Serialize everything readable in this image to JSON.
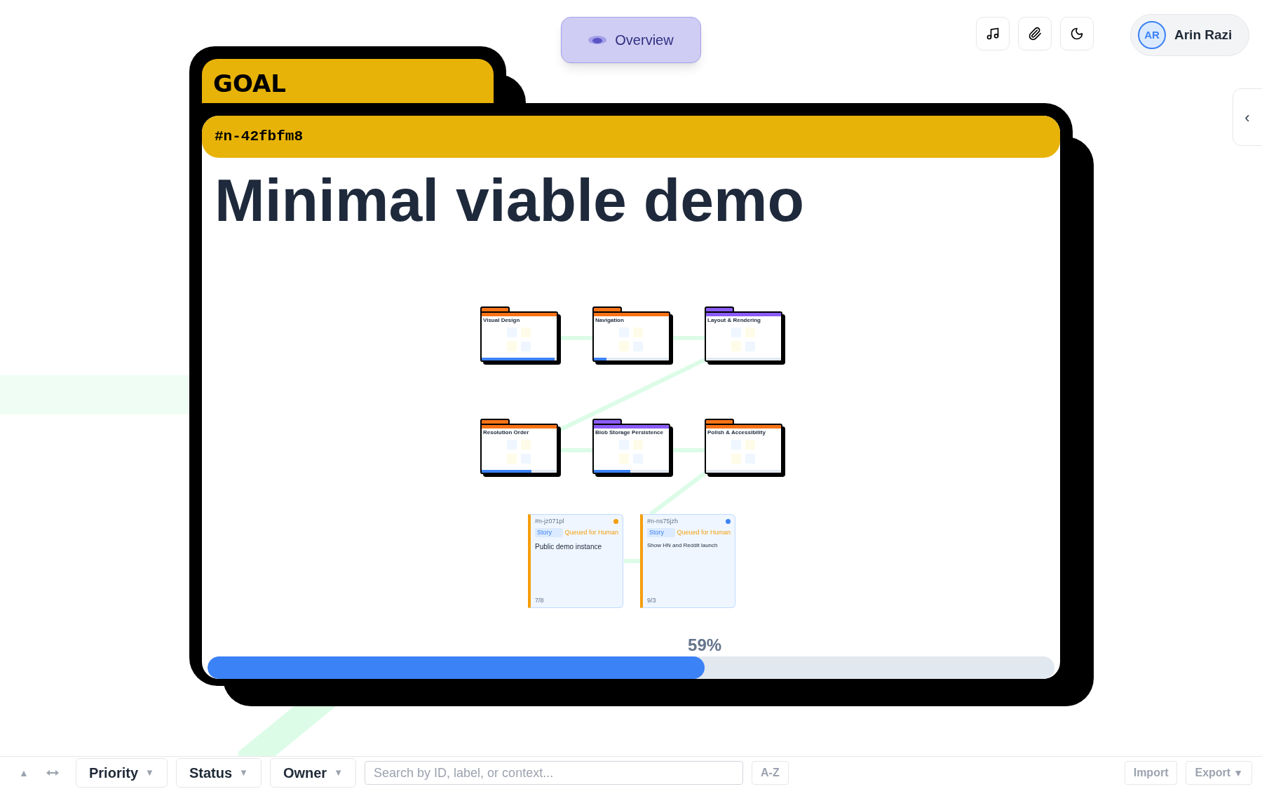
{
  "top_bar": {
    "overview_button": "Overview",
    "user": {
      "initials": "AR",
      "name": "Arin Razi"
    }
  },
  "side_toggle": "‹",
  "goal": {
    "tab": "GOAL",
    "id": "#n-42fbfm8",
    "title": "Minimal viable demo",
    "epics": [
      {
        "title": "Visual Design",
        "color": "#f97316",
        "level": 0.97
      },
      {
        "title": "Navigation",
        "color": "#f97316",
        "level": 0.17
      },
      {
        "title": "Layout & Rendering",
        "color": "#8b5cf6",
        "level": 0
      },
      {
        "title": "Resolution Order",
        "color": "#f97316",
        "level": 0.66
      },
      {
        "title": "Blob Storage Persistence",
        "color": "#8b5cf6",
        "level": 0.49
      },
      {
        "title": "Polish & Accessibility",
        "color": "#f97316",
        "level": 0
      }
    ],
    "stories": [
      {
        "id": "#n-jz071pl",
        "type": "Story",
        "status": "Queued for Human",
        "title": "Public demo instance",
        "count": "7/8",
        "color": "#f59e0b"
      },
      {
        "id": "#n-ns75jzh",
        "type": "Story",
        "status": "Queued for Human",
        "title": "Show HN and Reddit launch",
        "count": "9/3",
        "color": "#3b82f6"
      }
    ],
    "progress": {
      "label": "59%",
      "level": 0.587
    }
  },
  "filter_bar": {
    "collapse": "▲",
    "filters": [
      {
        "label": "Priority",
        "caret": "▼"
      },
      {
        "label": "Status",
        "caret": "▼"
      },
      {
        "label": "Owner",
        "caret": "▼"
      }
    ],
    "search": {
      "placeholder": "Search by ID, label, or context..."
    },
    "sort": "A-Z",
    "import": "Import",
    "export": {
      "label": "Export",
      "caret": "▼"
    }
  }
}
